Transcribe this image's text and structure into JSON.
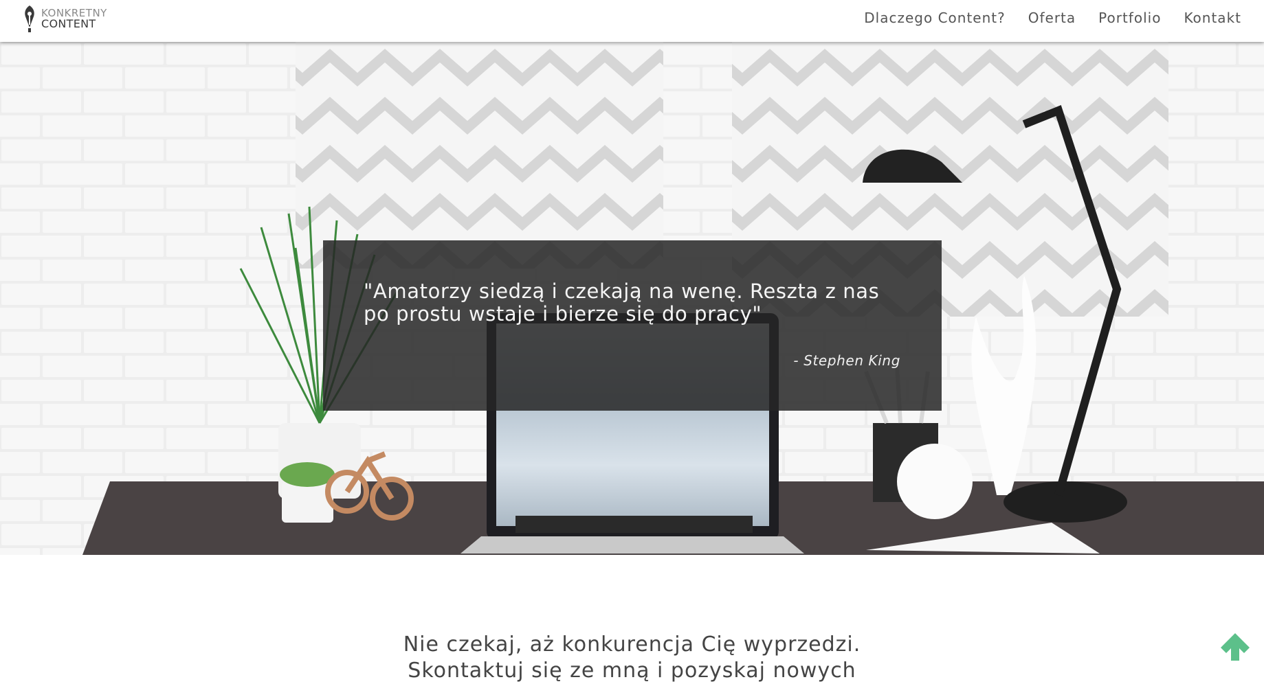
{
  "header": {
    "logo": {
      "line1": "KONKRETNY",
      "line2": "CONTENT",
      "icon": "pen-nib-icon"
    },
    "nav": [
      {
        "label": "Dlaczego Content?"
      },
      {
        "label": "Oferta"
      },
      {
        "label": "Portfolio"
      },
      {
        "label": "Kontakt"
      }
    ]
  },
  "hero": {
    "quote": "\"Amatorzy siedzą i czekają na wenę. Reszta z nas po prostu wstaje i bierze się do pracy\"",
    "author": "- Stephen King"
  },
  "cta": {
    "line1": "Nie czekaj, aż konkurencja Cię wyprzedzi.",
    "line2": "Skontaktuj się ze mną i pozyskaj nowych"
  },
  "scroll_top": {
    "icon": "arrow-up-icon",
    "color": "#5cc08a"
  }
}
